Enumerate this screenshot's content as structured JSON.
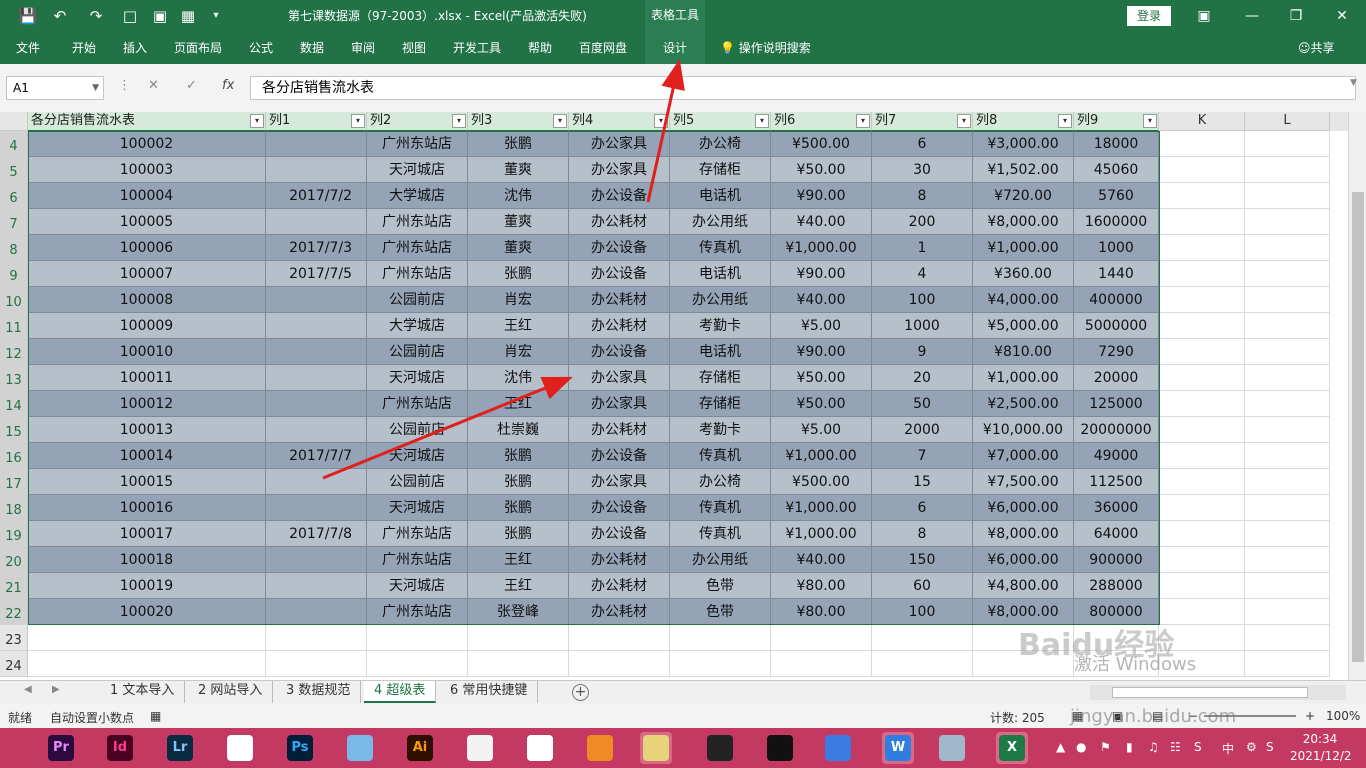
{
  "titlebar": {
    "doc_title": "第七课数据源（97-2003）.xlsx  -  Excel(产品激活失败)",
    "tool_tab": "表格工具",
    "login": "登录"
  },
  "ribbon": {
    "tabs": [
      "文件",
      "开始",
      "插入",
      "页面布局",
      "公式",
      "数据",
      "审阅",
      "视图",
      "开发工具",
      "帮助",
      "百度网盘",
      "设计"
    ],
    "active_tab": "设计",
    "tell_me": "操作说明搜索",
    "share": "共享"
  },
  "formula_bar": {
    "name_box": "A1",
    "formula": "各分店销售流水表"
  },
  "columns": {
    "table_headers": [
      "各分店销售流水表",
      "列1",
      "列2",
      "列3",
      "列4",
      "列5",
      "列6",
      "列7",
      "列8",
      "列9"
    ],
    "extra_letters": [
      "K",
      "L"
    ]
  },
  "rows": [
    {
      "n": "4",
      "c": [
        "100002",
        "",
        "广州东站店",
        "张鹏",
        "办公家具",
        "办公椅",
        "¥500.00",
        "6",
        "¥3,000.00",
        "18000"
      ]
    },
    {
      "n": "5",
      "c": [
        "100003",
        "",
        "天河城店",
        "董爽",
        "办公家具",
        "存储柜",
        "¥50.00",
        "30",
        "¥1,502.00",
        "45060"
      ]
    },
    {
      "n": "6",
      "c": [
        "100004",
        "2017/7/2",
        "大学城店",
        "沈伟",
        "办公设备",
        "电话机",
        "¥90.00",
        "8",
        "¥720.00",
        "5760"
      ]
    },
    {
      "n": "7",
      "c": [
        "100005",
        "",
        "广州东站店",
        "董爽",
        "办公耗材",
        "办公用纸",
        "¥40.00",
        "200",
        "¥8,000.00",
        "1600000"
      ]
    },
    {
      "n": "8",
      "c": [
        "100006",
        "2017/7/3",
        "广州东站店",
        "董爽",
        "办公设备",
        "传真机",
        "¥1,000.00",
        "1",
        "¥1,000.00",
        "1000"
      ]
    },
    {
      "n": "9",
      "c": [
        "100007",
        "2017/7/5",
        "广州东站店",
        "张鹏",
        "办公设备",
        "电话机",
        "¥90.00",
        "4",
        "¥360.00",
        "1440"
      ]
    },
    {
      "n": "10",
      "c": [
        "100008",
        "",
        "公园前店",
        "肖宏",
        "办公耗材",
        "办公用纸",
        "¥40.00",
        "100",
        "¥4,000.00",
        "400000"
      ]
    },
    {
      "n": "11",
      "c": [
        "100009",
        "",
        "大学城店",
        "王红",
        "办公耗材",
        "考勤卡",
        "¥5.00",
        "1000",
        "¥5,000.00",
        "5000000"
      ]
    },
    {
      "n": "12",
      "c": [
        "100010",
        "",
        "公园前店",
        "肖宏",
        "办公设备",
        "电话机",
        "¥90.00",
        "9",
        "¥810.00",
        "7290"
      ]
    },
    {
      "n": "13",
      "c": [
        "100011",
        "",
        "天河城店",
        "沈伟",
        "办公家具",
        "存储柜",
        "¥50.00",
        "20",
        "¥1,000.00",
        "20000"
      ]
    },
    {
      "n": "14",
      "c": [
        "100012",
        "",
        "广州东站店",
        "王红",
        "办公家具",
        "存储柜",
        "¥50.00",
        "50",
        "¥2,500.00",
        "125000"
      ]
    },
    {
      "n": "15",
      "c": [
        "100013",
        "",
        "公园前店",
        "杜崇巍",
        "办公耗材",
        "考勤卡",
        "¥5.00",
        "2000",
        "¥10,000.00",
        "20000000"
      ]
    },
    {
      "n": "16",
      "c": [
        "100014",
        "2017/7/7",
        "天河城店",
        "张鹏",
        "办公设备",
        "传真机",
        "¥1,000.00",
        "7",
        "¥7,000.00",
        "49000"
      ]
    },
    {
      "n": "17",
      "c": [
        "100015",
        "",
        "公园前店",
        "张鹏",
        "办公家具",
        "办公椅",
        "¥500.00",
        "15",
        "¥7,500.00",
        "112500"
      ]
    },
    {
      "n": "18",
      "c": [
        "100016",
        "",
        "天河城店",
        "张鹏",
        "办公设备",
        "传真机",
        "¥1,000.00",
        "6",
        "¥6,000.00",
        "36000"
      ]
    },
    {
      "n": "19",
      "c": [
        "100017",
        "2017/7/8",
        "广州东站店",
        "张鹏",
        "办公设备",
        "传真机",
        "¥1,000.00",
        "8",
        "¥8,000.00",
        "64000"
      ]
    },
    {
      "n": "20",
      "c": [
        "100018",
        "",
        "广州东站店",
        "王红",
        "办公耗材",
        "办公用纸",
        "¥40.00",
        "150",
        "¥6,000.00",
        "900000"
      ]
    },
    {
      "n": "21",
      "c": [
        "100019",
        "",
        "天河城店",
        "王红",
        "办公耗材",
        "色带",
        "¥80.00",
        "60",
        "¥4,800.00",
        "288000"
      ]
    },
    {
      "n": "22",
      "c": [
        "100020",
        "",
        "广州东站店",
        "张登峰",
        "办公耗材",
        "色带",
        "¥80.00",
        "100",
        "¥8,000.00",
        "800000"
      ]
    }
  ],
  "empty_rows": [
    "23",
    "24"
  ],
  "sheets": [
    "1 文本导入",
    "2 网站导入",
    "3 数据规范",
    "4 超级表",
    "6 常用快捷键"
  ],
  "active_sheet": "4 超级表",
  "status": {
    "ready": "就绪",
    "auto_decimal": "自动设置小数点",
    "count": "计数: 205",
    "zoom": "100%"
  },
  "taskbar": {
    "apps": [
      "Pr",
      "Id",
      "Lr",
      "",
      "Ps",
      "",
      "Ai",
      "",
      "",
      "",
      "",
      "",
      "",
      "",
      "W",
      "",
      "X"
    ],
    "time": "20:34",
    "date": "2021/12/2"
  },
  "watermark": {
    "text": "Baidu经验",
    "activate": "激活 Windows",
    "url": "jingyan.baidu.com"
  }
}
